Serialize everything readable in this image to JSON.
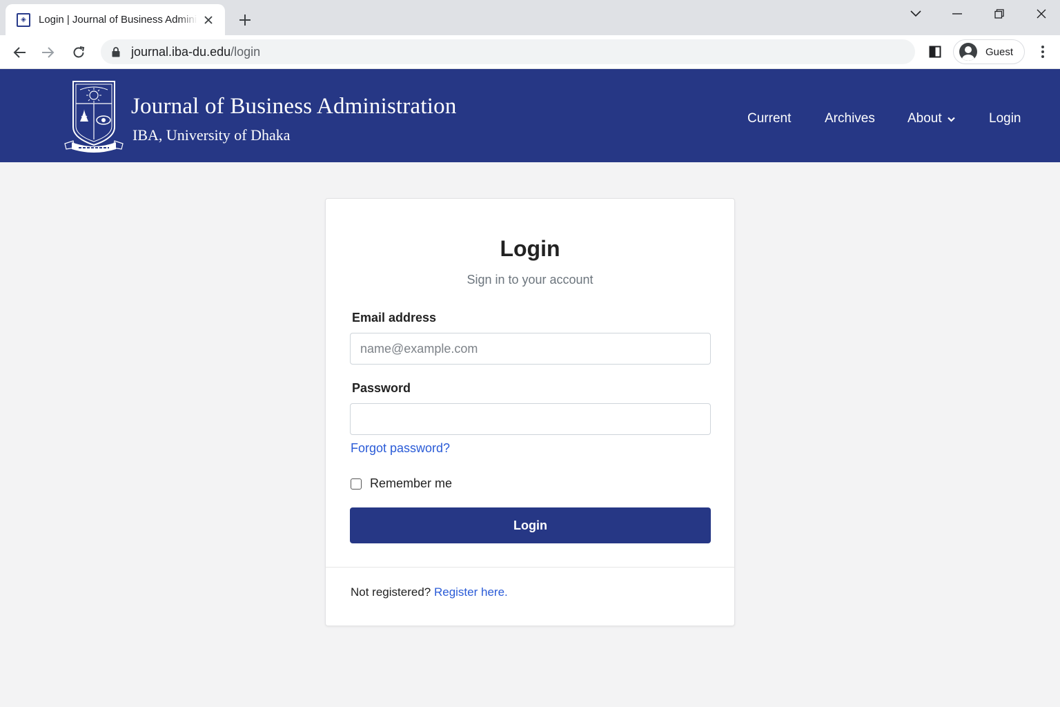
{
  "browser": {
    "tab_title": "Login | Journal of Business Administration",
    "url_host": "journal.iba-du.edu",
    "url_path": "/login",
    "profile_label": "Guest"
  },
  "site": {
    "title": "Journal of Business Administration",
    "subtitle": "IBA, University of Dhaka",
    "nav": {
      "current": "Current",
      "archives": "Archives",
      "about": "About",
      "login": "Login"
    },
    "header_color": "#263785"
  },
  "login": {
    "title": "Login",
    "subtitle": "Sign in to your account",
    "email_label": "Email address",
    "email_placeholder": "name@example.com",
    "email_value": "",
    "password_label": "Password",
    "password_value": "",
    "forgot_link": "Forgot password?",
    "remember_label": "Remember me",
    "remember_checked": false,
    "submit_label": "Login",
    "register_prompt": "Not registered?",
    "register_link": "Register here."
  },
  "colors": {
    "accent": "#263785",
    "link": "#2a5bd7",
    "page_background": "#f3f3f4"
  }
}
